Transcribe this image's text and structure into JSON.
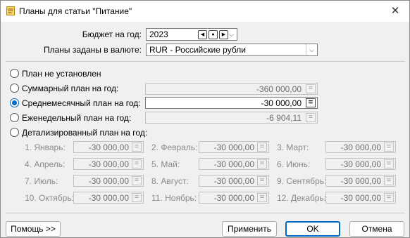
{
  "window": {
    "title": "Планы для статьи \"Питание\"",
    "close_glyph": "✕"
  },
  "budget_year": {
    "label": "Бюджет на год:",
    "value": "2023"
  },
  "currency": {
    "label": "Планы заданы в валюте:",
    "value": "RUR - Российские рубли"
  },
  "options": {
    "none": {
      "label": "План не установлен"
    },
    "total": {
      "label": "Суммарный план на год:",
      "value": "-360 000,00"
    },
    "monthly": {
      "label": "Среднемесячный план на год:",
      "value": "-30 000,00"
    },
    "weekly": {
      "label": "Еженедельный план на год:",
      "value": "-6 904,11"
    },
    "detailed": {
      "label": "Детализированный план на год:"
    }
  },
  "selected_option": "monthly",
  "months": [
    {
      "label": "1. Январь:",
      "value": "-30 000,00"
    },
    {
      "label": "2. Февраль:",
      "value": "-30 000,00"
    },
    {
      "label": "3. Март:",
      "value": "-30 000,00"
    },
    {
      "label": "4. Апрель:",
      "value": "-30 000,00"
    },
    {
      "label": "5. Май:",
      "value": "-30 000,00"
    },
    {
      "label": "6. Июнь:",
      "value": "-30 000,00"
    },
    {
      "label": "7. Июль:",
      "value": "-30 000,00"
    },
    {
      "label": "8. Август:",
      "value": "-30 000,00"
    },
    {
      "label": "9. Сентябрь:",
      "value": "-30 000,00"
    },
    {
      "label": "10. Октябрь:",
      "value": "-30 000,00"
    },
    {
      "label": "11. Ноябрь:",
      "value": "-30 000,00"
    },
    {
      "label": "12. Декабрь:",
      "value": "-30 000,00"
    }
  ],
  "buttons": {
    "help": "Помощь >>",
    "apply": "Применить",
    "ok": "OK",
    "cancel": "Отмена"
  },
  "colors": {
    "accent": "#0067c0",
    "disabled_text": "#8a8a8a"
  }
}
